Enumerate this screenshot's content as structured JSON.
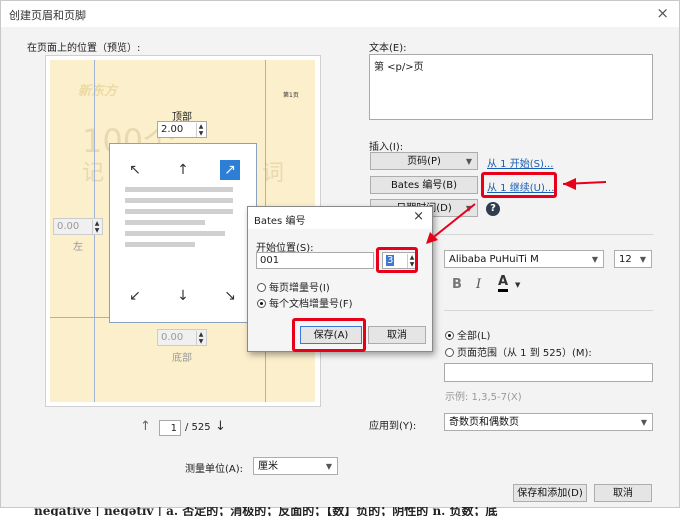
{
  "dialog": {
    "title": "创建页眉和页脚",
    "close_glyph": "×"
  },
  "preview": {
    "section_label": "在页面上的位置（预览）:",
    "top_label": "顶部",
    "top_value": "2.00",
    "left_value": "0.00",
    "left_label": "左",
    "bottom_value": "0.00",
    "bottom_label": "底部",
    "page_thumb_logo": "新东方",
    "page_thumb_num": "第1页",
    "page_thumb_big": "100个",
    "page_thumb_sub": "记",
    "page_thumb_word": "词",
    "page_current": "1",
    "page_total": "/ 525"
  },
  "unit": {
    "label": "测量单位(A):",
    "value": "厘米"
  },
  "text_section": {
    "label": "文本(E):",
    "value": "第 <p/>页"
  },
  "insert": {
    "label": "插入(I):",
    "page_code_btn": "页码(P)",
    "page_code_link": "从 1 开始(S)...",
    "bates_btn": "Bates 编号(B)",
    "bates_link": "从 1 继续(U)...",
    "date_btn": "日期时间(D)",
    "help_glyph": "?"
  },
  "font": {
    "family": "Alibaba PuHuiTi M",
    "size": "12",
    "bold": "B",
    "italic": "I",
    "color_glyph": "A"
  },
  "range": {
    "all_label": "全部(L)",
    "range_label": "页面范围（从 1 到 525）(M):",
    "range_value": "",
    "example": "示例: 1,3,5-7(X)",
    "apply_label": "应用到(Y):",
    "apply_value": "奇数页和偶数页"
  },
  "footer_buttons": {
    "save_add": "保存和添加(D)",
    "cancel": "取消"
  },
  "bates_modal": {
    "title": "Bates 编号",
    "close_glyph": "×",
    "start_label": "开始位置(S):",
    "start_value": "001",
    "digits_value": "3",
    "opt_per_page": "每页增量号(I)",
    "opt_per_doc": "每个文档增量号(F)",
    "save": "保存(A)",
    "cancel": "取消"
  },
  "background_text": "negative | neɡətɪv | a. 否定的；消极的；反面的；【数】负的；阴性的 n. 负数；底",
  "colors": {
    "accent_red": "#e8001a",
    "link_blue": "#1a5fb4",
    "preview_bg": "#fbefcc"
  }
}
